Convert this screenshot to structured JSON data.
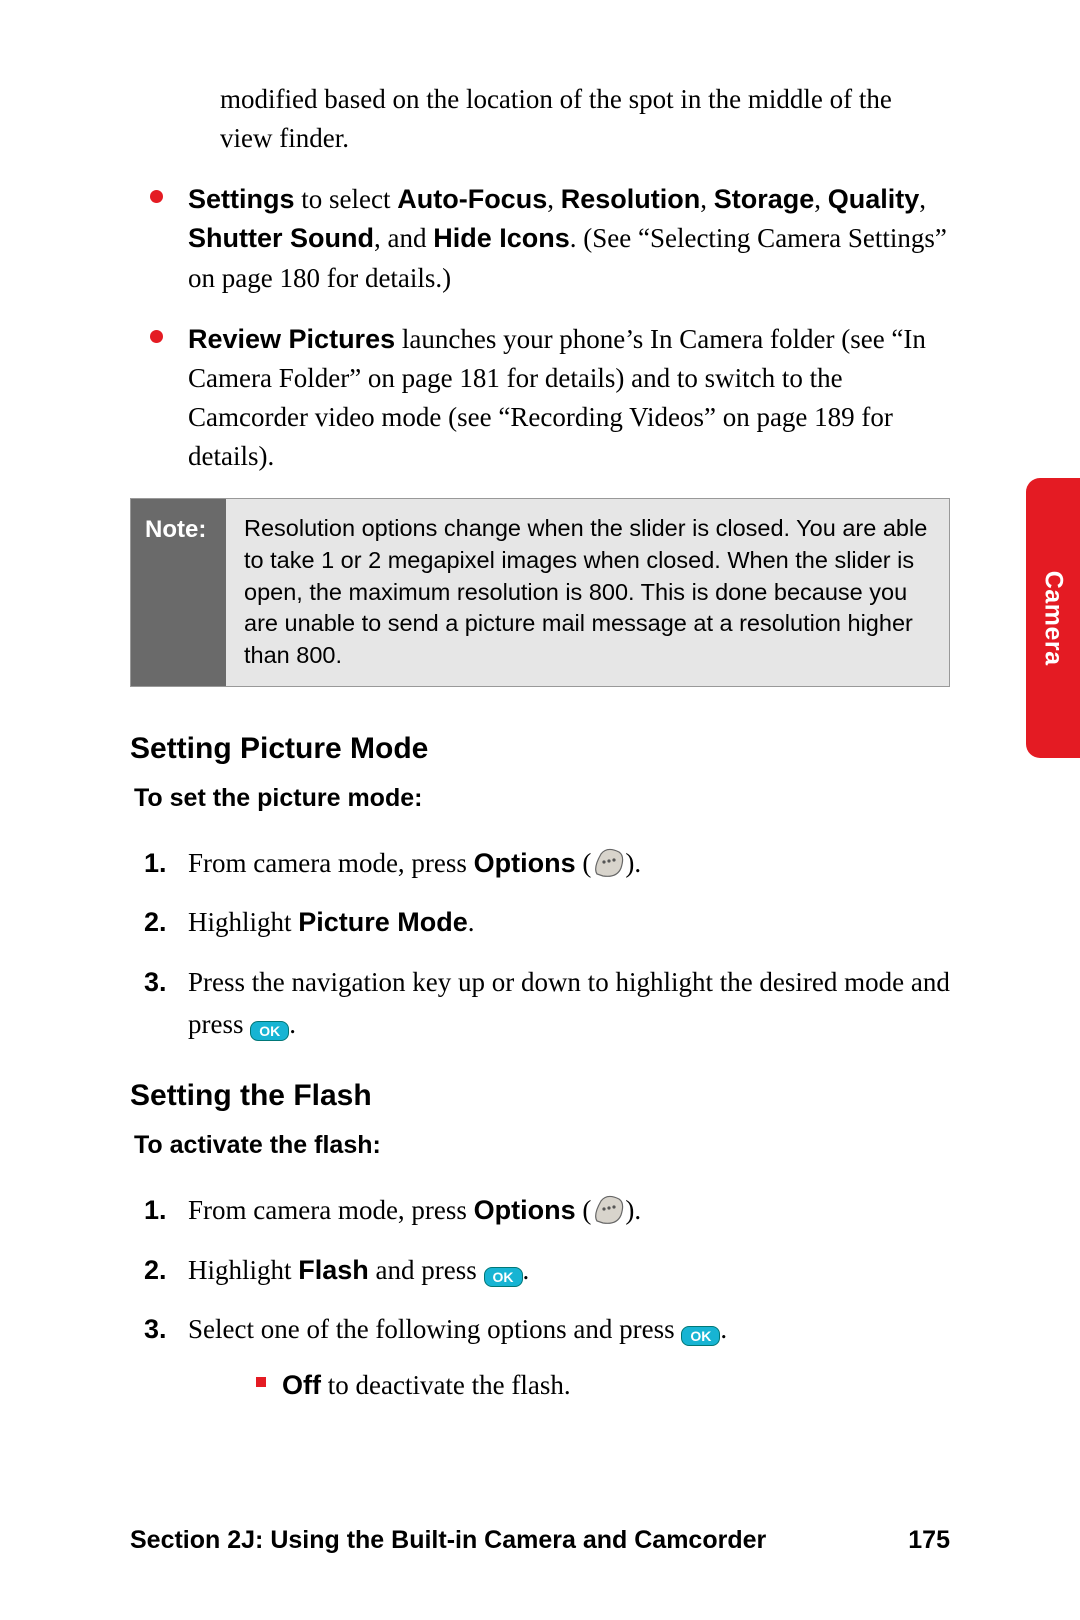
{
  "sideTab": "Camera",
  "introContinuation": "modified based on the location of the spot in the middle of the view finder.",
  "bullets": [
    {
      "lead": "Settings",
      "mid1": " to select ",
      "opts": [
        "Auto-Focus",
        "Resolution",
        "Storage",
        "Quality",
        "Shutter Sound",
        "Hide Icons"
      ],
      "and": ", and ",
      "tail": ". (See “Selecting Camera Settings” on page 180 for details.)"
    },
    {
      "lead": "Review Pictures",
      "tail": " launches your phone’s In Camera folder (see “In Camera Folder” on page 181 for details) and to switch to the Camcorder video mode (see “Recording Videos” on page 189 for details)."
    }
  ],
  "note": {
    "label": "Note:",
    "body": "Resolution options change when the slider is closed. You are able to take 1 or 2 megapixel images when closed. When the slider is open, the maximum resolution is 800. This is done because you are unable to send a picture mail message at a resolution higher than 800."
  },
  "sections": [
    {
      "heading": "Setting Picture Mode",
      "task": "To set the picture mode:",
      "steps": [
        {
          "pre": "From camera mode, press ",
          "bold": "Options",
          "post": " (",
          "icon": "softkey",
          "close": ")."
        },
        {
          "pre": "Highlight ",
          "bold": "Picture Mode",
          "post": "."
        },
        {
          "pre": "Press the navigation key up or down to highlight the desired mode and press ",
          "icon": "ok",
          "post": "."
        }
      ]
    },
    {
      "heading": "Setting the Flash",
      "task": "To activate the flash:",
      "steps": [
        {
          "pre": "From camera mode, press ",
          "bold": "Options",
          "post": " (",
          "icon": "softkey",
          "close": ")."
        },
        {
          "pre": "Highlight ",
          "bold": "Flash",
          "post": " and press ",
          "icon": "ok",
          "post2": "."
        },
        {
          "pre": "Select one of the following options and press ",
          "icon": "ok",
          "post": ".",
          "sub": {
            "bold": "Off",
            "tail": " to deactivate the flash."
          }
        }
      ]
    }
  ],
  "footer": {
    "section": "Section 2J: Using the Built-in Camera and Camcorder",
    "page": "175"
  },
  "okLabel": "OK"
}
